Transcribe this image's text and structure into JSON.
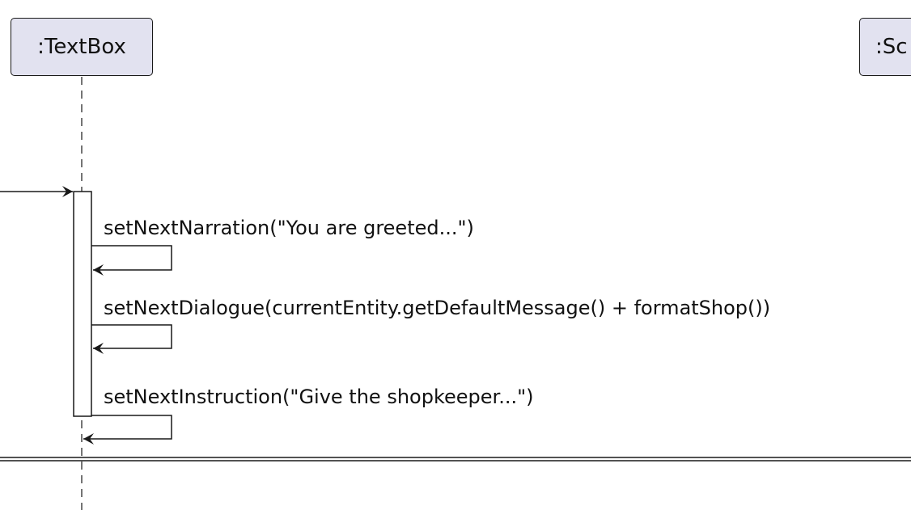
{
  "participants": [
    {
      "label": ":TextBox"
    },
    {
      "label": ":Sc"
    }
  ],
  "messages": [
    {
      "label": "setNextNarration(\"You are greeted...\")"
    },
    {
      "label": "setNextDialogue(currentEntity.getDefaultMessage() + formatShop())"
    },
    {
      "label": "setNextInstruction(\"Give the shopkeeper...\")"
    }
  ],
  "colors": {
    "participant_fill": "#e2e2f0",
    "line": "#181818",
    "activation_fill": "#ffffff"
  }
}
